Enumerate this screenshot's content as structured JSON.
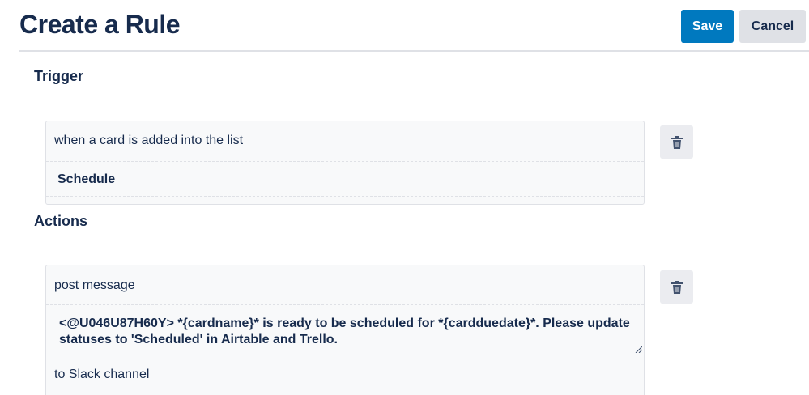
{
  "header": {
    "title": "Create a Rule",
    "save_label": "Save",
    "cancel_label": "Cancel"
  },
  "trigger": {
    "section_label": "Trigger",
    "condition": "when a card is added into the list",
    "list_name": "Schedule"
  },
  "actions": {
    "section_label": "Actions",
    "action_type": "post message",
    "message": "<@U046U87H60Y> *{cardname}* is ready to be scheduled for *{cardduedate}*. Please update statuses to 'Scheduled' in Airtable and Trello.",
    "destination": "to Slack channel"
  },
  "icons": {
    "delete": "trash-icon",
    "resize": "resize-handle-icon"
  },
  "colors": {
    "primary": "#0079bf",
    "secondary": "#dfe1e6",
    "text": "#172b4d"
  }
}
